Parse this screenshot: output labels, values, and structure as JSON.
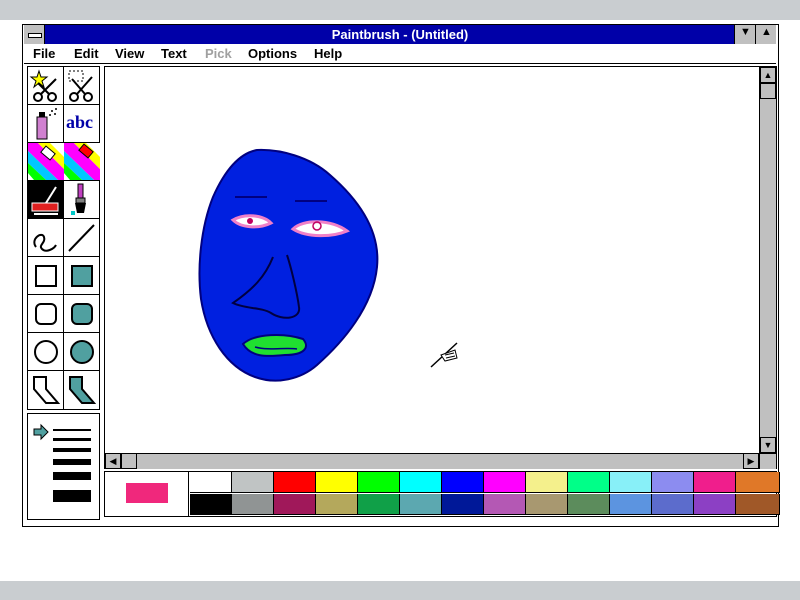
{
  "window": {
    "title": "Paintbrush - (Untitled)",
    "minimize_glyph": "▼",
    "maximize_glyph": "▲"
  },
  "menu": {
    "items": [
      {
        "label": "File",
        "enabled": true
      },
      {
        "label": "Edit",
        "enabled": true
      },
      {
        "label": "View",
        "enabled": true
      },
      {
        "label": "Text",
        "enabled": true
      },
      {
        "label": "Pick",
        "enabled": false
      },
      {
        "label": "Options",
        "enabled": true
      },
      {
        "label": "Help",
        "enabled": true
      }
    ]
  },
  "toolbox": {
    "tools": [
      {
        "id": "scissors-star",
        "icon": "star-scissors-icon"
      },
      {
        "id": "scissors-pick",
        "icon": "pick-scissors-icon"
      },
      {
        "id": "airbrush",
        "icon": "airbrush-icon"
      },
      {
        "id": "text",
        "icon": "text-tool-icon",
        "label": "abc"
      },
      {
        "id": "color-eraser",
        "icon": "color-eraser-icon"
      },
      {
        "id": "eraser",
        "icon": "eraser-icon"
      },
      {
        "id": "paint-roller",
        "icon": "paint-roller-icon",
        "selected": true
      },
      {
        "id": "brush",
        "icon": "brush-icon"
      },
      {
        "id": "curve",
        "icon": "curve-icon"
      },
      {
        "id": "line",
        "icon": "line-icon"
      },
      {
        "id": "box",
        "icon": "box-icon"
      },
      {
        "id": "filled-box",
        "icon": "filled-box-icon"
      },
      {
        "id": "rounded-box",
        "icon": "rounded-box-icon"
      },
      {
        "id": "filled-rounded-box",
        "icon": "filled-rounded-box-icon"
      },
      {
        "id": "circle",
        "icon": "circle-icon"
      },
      {
        "id": "filled-circle",
        "icon": "filled-circle-icon"
      },
      {
        "id": "polygon",
        "icon": "polygon-icon"
      },
      {
        "id": "filled-polygon",
        "icon": "filled-polygon-icon"
      }
    ]
  },
  "line_widths": {
    "selected_index": 0,
    "pointer_icon": "arrow-right-icon",
    "count": 6
  },
  "palette": {
    "foreground": "#f0287c",
    "background": "#ffffff",
    "top_row": [
      "#ffffff",
      "#c0c4c4",
      "#ff0000",
      "#ffff00",
      "#00ff00",
      "#00ffff",
      "#0000ff",
      "#ff00ff",
      "#f4f08c",
      "#00ff88",
      "#88f0f8",
      "#8c8cf0",
      "#f01e8c",
      "#e07828"
    ],
    "bottom_row": [
      "#000000",
      "#909494",
      "#a0185a",
      "#b4a85c",
      "#10a048",
      "#5ca8b0",
      "#001898",
      "#b458b4",
      "#a89870",
      "#5c8c5c",
      "#5c94e0",
      "#5c6ccc",
      "#8c40c4",
      "#a05828"
    ]
  },
  "canvas": {
    "face_color": "#0020e0",
    "lips_color": "#20e030",
    "eye_color": "#f080c8",
    "cursor_icon": "airbrush-cursor-icon"
  }
}
